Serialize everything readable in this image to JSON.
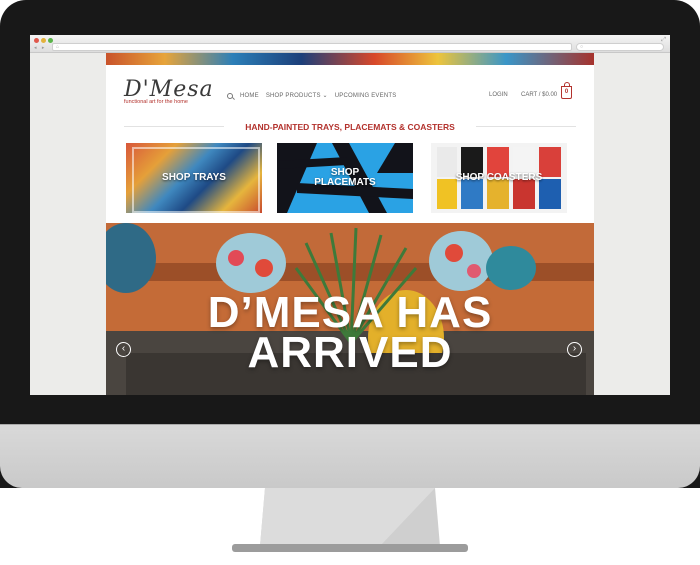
{
  "site": {
    "logo": "D'Mesa",
    "logo_tagline": "functional art for the home"
  },
  "nav": {
    "items": [
      "HOME",
      "SHOP PRODUCTS ⌄",
      "UPCOMING EVENTS"
    ],
    "login": "LOGIN",
    "cart": "CART / $0.00",
    "cart_count": "0"
  },
  "tagline": "HAND-PAINTED TRAYS, PLACEMATS & COASTERS",
  "categories": [
    {
      "label": "SHOP TRAYS"
    },
    {
      "label": "SHOP PLACEMATS"
    },
    {
      "label": "SHOP COASTERS"
    }
  ],
  "hero": {
    "line1": "D’MESA HAS",
    "line2": "ARRIVED",
    "prev": "‹",
    "next": "›"
  },
  "colors": {
    "accent": "#b3322d"
  }
}
